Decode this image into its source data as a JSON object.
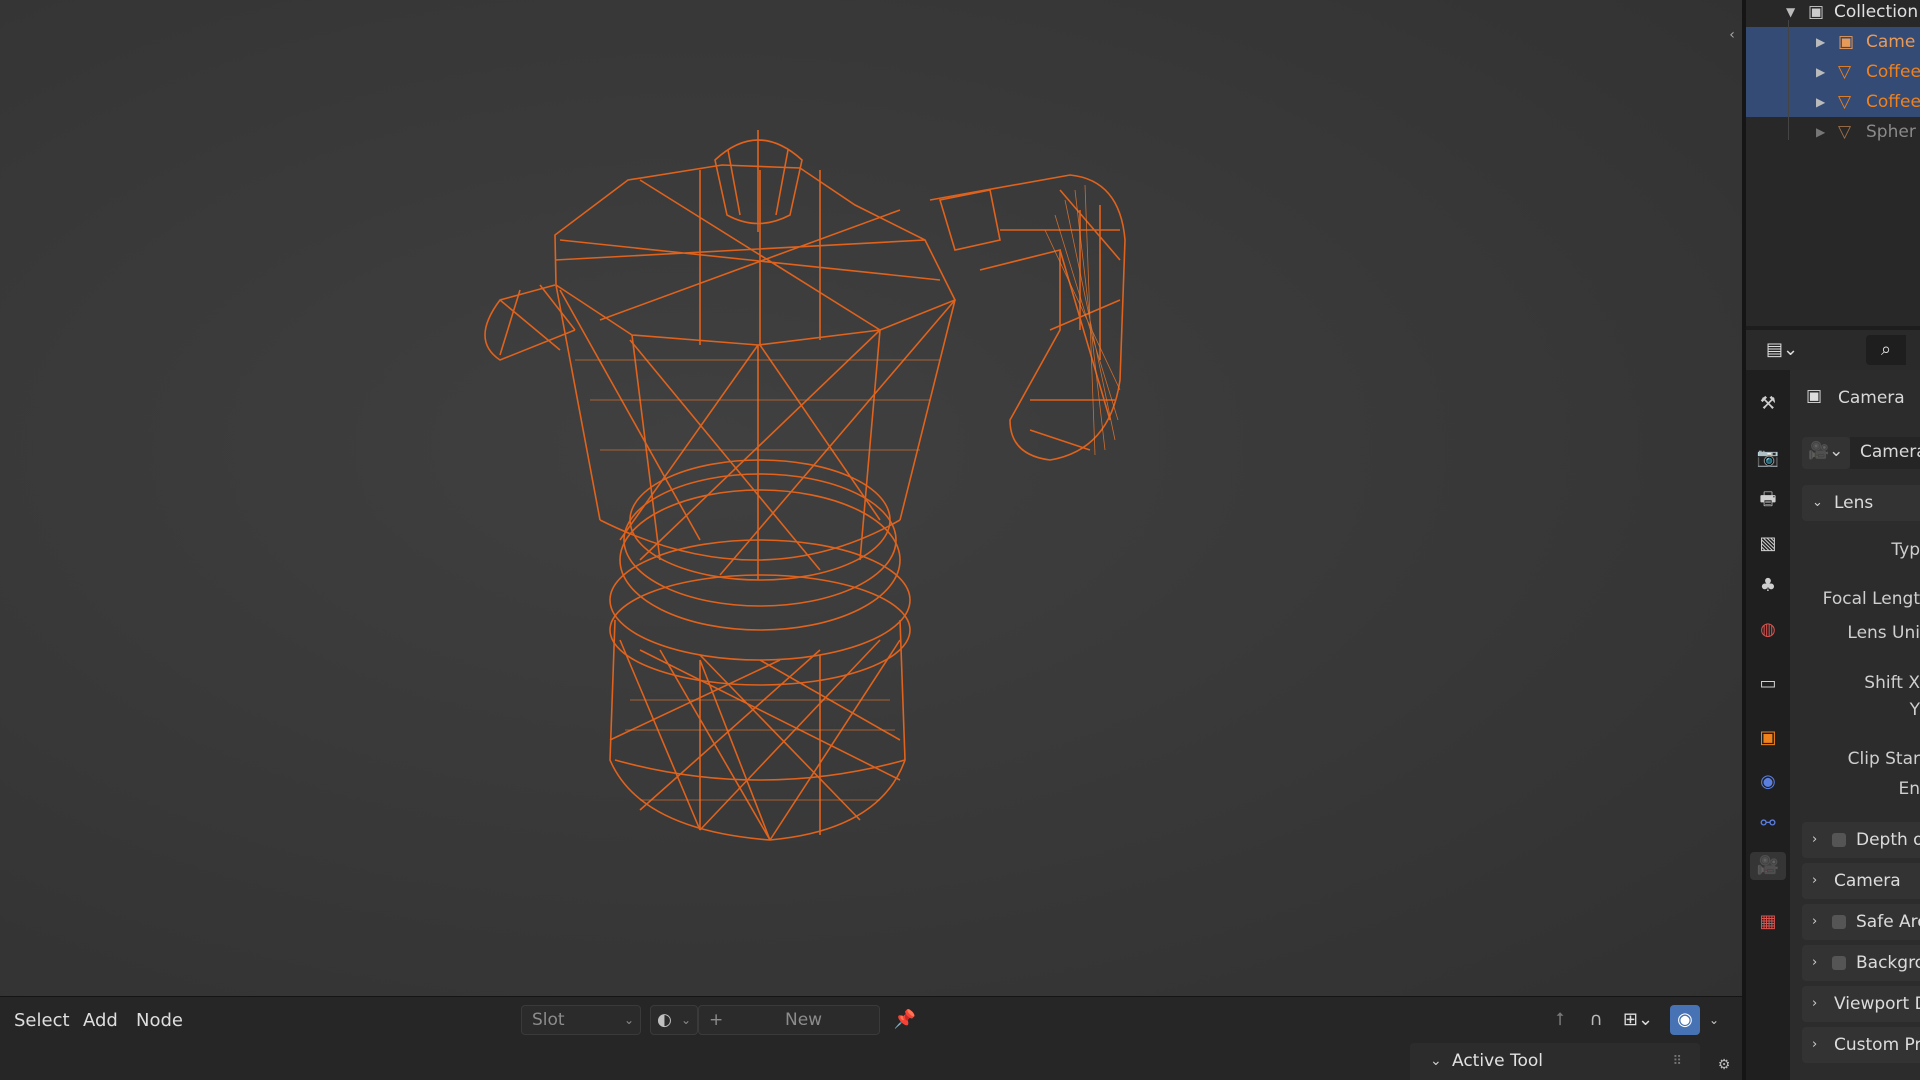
{
  "node_header": {
    "menu": [
      "Select",
      "Add",
      "Node"
    ],
    "slot_label": "Slot",
    "new_label": "New"
  },
  "active_tool": {
    "label": "Active Tool"
  },
  "outliner": {
    "collection": "Collection",
    "items": [
      {
        "name": "Came",
        "color": "#e89a58",
        "selected": true
      },
      {
        "name": "Coffee",
        "color": "#f0821e",
        "selected": true
      },
      {
        "name": "Coffee",
        "color": "#f0821e",
        "selected": true
      },
      {
        "name": "Spher",
        "color": "#8a8a8a",
        "selected": false
      }
    ]
  },
  "properties": {
    "object_name": "Camera",
    "data_name": "Camera",
    "lens_panel": "Lens",
    "fields": [
      "Typ",
      "Focal Lengt",
      "Lens Uni",
      "Shift X",
      "Y",
      "Clip Star",
      "En"
    ],
    "panels": [
      {
        "label": "Depth of",
        "checkbox": true
      },
      {
        "label": "Camera",
        "checkbox": false
      },
      {
        "label": "Safe Are",
        "checkbox": true
      },
      {
        "label": "Backgro",
        "checkbox": true
      },
      {
        "label": "Viewport D",
        "checkbox": false
      },
      {
        "label": "Custom Pro",
        "checkbox": false
      }
    ]
  },
  "colors": {
    "wire": "#e8651c",
    "selection": "#334b75",
    "viewport_bg": "#3a3a3a"
  }
}
